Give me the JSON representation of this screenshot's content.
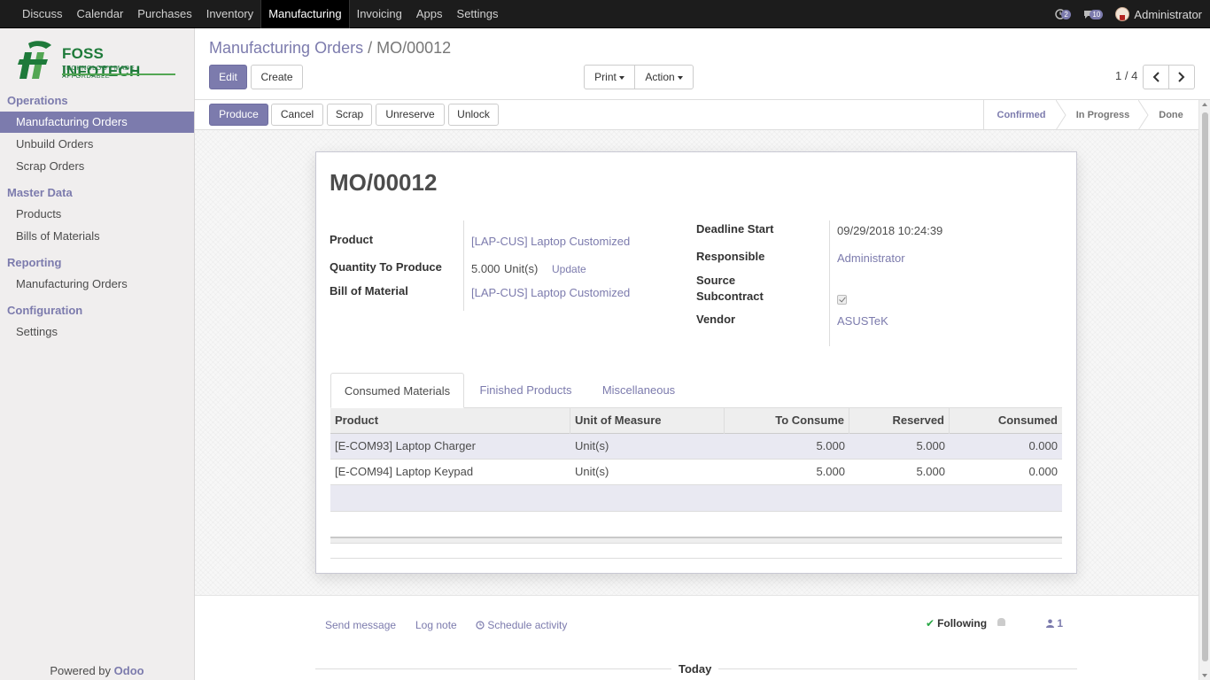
{
  "topnav": {
    "items": [
      "Discuss",
      "Calendar",
      "Purchases",
      "Inventory",
      "Manufacturing",
      "Invoicing",
      "Apps",
      "Settings"
    ],
    "active": "Manufacturing",
    "activity_badge": "2",
    "messages_badge": "10",
    "user": "Administrator"
  },
  "sidebar": {
    "logo_brand": "FOSS INFOTECH",
    "logo_tagline": "TECHNOLOGY MADE AFFORDABLE",
    "sections": [
      {
        "title": "Operations",
        "items": [
          "Manufacturing Orders",
          "Unbuild Orders",
          "Scrap Orders"
        ]
      },
      {
        "title": "Master Data",
        "items": [
          "Products",
          "Bills of Materials"
        ]
      },
      {
        "title": "Reporting",
        "items": [
          "Manufacturing Orders"
        ]
      },
      {
        "title": "Configuration",
        "items": [
          "Settings"
        ]
      }
    ],
    "powered_by": "Powered by",
    "powered_brand": "Odoo"
  },
  "breadcrumb": {
    "parent": "Manufacturing Orders",
    "separator": "/",
    "current": "MO/00012"
  },
  "toolbar": {
    "edit": "Edit",
    "create": "Create",
    "print": "Print",
    "action": "Action",
    "pager": "1 / 4"
  },
  "statusbar": {
    "buttons": [
      "Produce",
      "Cancel",
      "Scrap",
      "Unreserve",
      "Unlock"
    ],
    "stages": [
      "Confirmed",
      "In Progress",
      "Done"
    ],
    "current_stage": "Confirmed"
  },
  "form": {
    "title": "MO/00012",
    "product_label": "Product",
    "product": "[LAP-CUS] Laptop Customized",
    "qty_label": "Quantity To Produce",
    "qty": "5.000",
    "uom": "Unit(s)",
    "update": "Update",
    "bom_label": "Bill of Material",
    "bom": "[LAP-CUS] Laptop Customized",
    "deadline_label": "Deadline Start",
    "deadline": "09/29/2018 10:24:39",
    "responsible_label": "Responsible",
    "responsible": "Administrator",
    "source_label": "Source",
    "subcontract_label": "Subcontract",
    "subcontract_checked": true,
    "vendor_label": "Vendor",
    "vendor": "ASUSTeK"
  },
  "tabs": [
    "Consumed Materials",
    "Finished Products",
    "Miscellaneous"
  ],
  "table": {
    "headers": [
      "Product",
      "Unit of Measure",
      "To Consume",
      "Reserved",
      "Consumed"
    ],
    "rows": [
      [
        "[E-COM93] Laptop Charger",
        "Unit(s)",
        "5.000",
        "5.000",
        "0.000"
      ],
      [
        "[E-COM94] Laptop Keypad",
        "Unit(s)",
        "5.000",
        "5.000",
        "0.000"
      ]
    ]
  },
  "chatter": {
    "send_message": "Send message",
    "log_note": "Log note",
    "schedule_activity": "Schedule activity",
    "following": "Following",
    "followers": "1",
    "today": "Today"
  },
  "colors": {
    "accent": "#7c7bad",
    "topbar": "#1c1c1c",
    "sidebar": "#f0eeee",
    "link": "#7c7bad"
  }
}
